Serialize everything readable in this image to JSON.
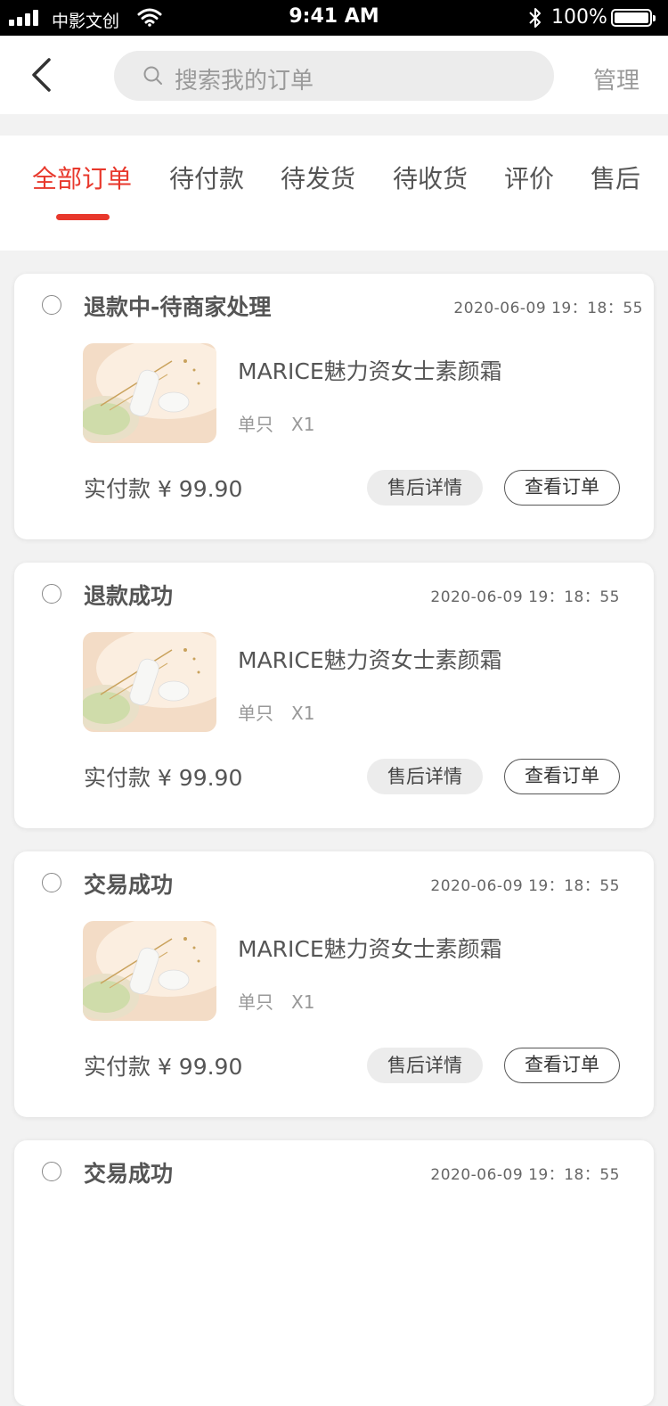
{
  "status_bar": {
    "carrier": "中影文创",
    "time": "9:41 AM",
    "battery": "100%"
  },
  "header": {
    "search_placeholder": "搜索我的订单",
    "manage_label": "管理"
  },
  "tabs": [
    {
      "label": "全部订单",
      "active": true
    },
    {
      "label": "待付款",
      "active": false
    },
    {
      "label": "待发货",
      "active": false
    },
    {
      "label": "待收货",
      "active": false
    },
    {
      "label": "评价",
      "active": false
    },
    {
      "label": "售后",
      "active": false
    }
  ],
  "orders": [
    {
      "status": "退款中-待商家处理",
      "time": "2020-06-09 19：18：55",
      "product_name": "MARICE魅力资女士素颜霜",
      "quantity": "单只　X1",
      "paid": "实付款 ¥ 99.90",
      "aftersale_label": "售后详情",
      "view_label": "查看订单"
    },
    {
      "status": "退款成功",
      "time": "2020-06-09 19：18：55",
      "product_name": "MARICE魅力资女士素颜霜",
      "quantity": "单只　X1",
      "paid": "实付款 ¥ 99.90",
      "aftersale_label": "售后详情",
      "view_label": "查看订单"
    },
    {
      "status": "交易成功",
      "time": "2020-06-09 19：18：55",
      "product_name": "MARICE魅力资女士素颜霜",
      "quantity": "单只　X1",
      "paid": "实付款 ¥ 99.90",
      "aftersale_label": "售后详情",
      "view_label": "查看订单"
    },
    {
      "status": "交易成功",
      "time": "2020-06-09 19：18：55"
    }
  ],
  "colors": {
    "accent": "#e8382c",
    "page_bg": "#f2f2f2"
  }
}
